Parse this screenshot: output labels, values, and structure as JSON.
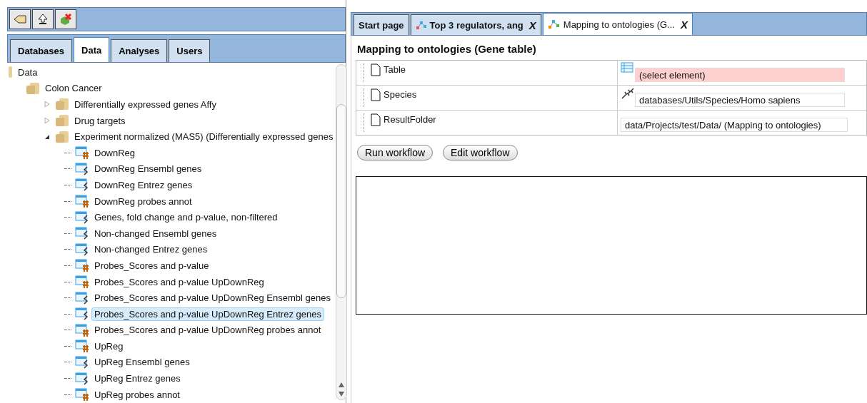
{
  "left_tabs": [
    {
      "label": "Databases",
      "selected": false
    },
    {
      "label": "Data",
      "selected": true
    },
    {
      "label": "Analyses",
      "selected": false
    },
    {
      "label": "Users",
      "selected": false
    }
  ],
  "tree": [
    {
      "label": "Data",
      "kind": "root",
      "selected": false,
      "children": [
        {
          "label": "Colon Cancer",
          "kind": "folder",
          "selected": false,
          "children": [
            {
              "label": "Differentially expressed genes Affy",
              "kind": "folder",
              "expanded": false,
              "selected": false
            },
            {
              "label": "Drug targets",
              "kind": "folder",
              "expanded": false,
              "selected": false
            },
            {
              "label": "Experiment normalized (MAS5) (Differentially expressed genes",
              "kind": "folder",
              "expanded": true,
              "selected": false,
              "children": [
                {
                  "label": "DownReg",
                  "kind": "probes",
                  "selected": false
                },
                {
                  "label": "DownReg Ensembl genes",
                  "kind": "genes",
                  "selected": false
                },
                {
                  "label": "DownReg Entrez genes",
                  "kind": "genes",
                  "selected": false
                },
                {
                  "label": "DownReg probes annot",
                  "kind": "probes",
                  "selected": false
                },
                {
                  "label": "Genes, fold change and p-value, non-filtered",
                  "kind": "genes",
                  "selected": false
                },
                {
                  "label": "Non-changed Ensembl genes",
                  "kind": "genes",
                  "selected": false
                },
                {
                  "label": "Non-changed Entrez genes",
                  "kind": "genes",
                  "selected": false
                },
                {
                  "label": "Probes_Scores and p-value",
                  "kind": "probes",
                  "selected": false
                },
                {
                  "label": "Probes_Scores and p-value UpDownReg",
                  "kind": "probes",
                  "selected": false
                },
                {
                  "label": "Probes_Scores and p-value UpDownReg Ensembl genes",
                  "kind": "genes",
                  "selected": false
                },
                {
                  "label": "Probes_Scores and p-value UpDownReg Entrez genes",
                  "kind": "genes",
                  "selected": true
                },
                {
                  "label": "Probes_Scores and p-value UpDownReg probes annot",
                  "kind": "probes",
                  "selected": false
                },
                {
                  "label": "UpReg",
                  "kind": "probes",
                  "selected": false
                },
                {
                  "label": "UpReg Ensembl genes",
                  "kind": "genes",
                  "selected": false
                },
                {
                  "label": "UpReg Entrez genes",
                  "kind": "genes",
                  "selected": false
                },
                {
                  "label": "UpReg probes annot",
                  "kind": "probes",
                  "selected": false
                }
              ]
            }
          ]
        }
      ]
    }
  ],
  "doc_tabs": [
    {
      "label": "Start page",
      "kind": "plain",
      "selected": false
    },
    {
      "label": "Top 3 regulators, ang",
      "kind": "diagram",
      "close": "X",
      "selected": false
    },
    {
      "label": "Mapping to ontologies (G...",
      "kind": "workflow",
      "close": "X",
      "selected": true
    }
  ],
  "form": {
    "title": "Mapping to ontologies (Gene table)",
    "parameters": [
      {
        "name": "Table",
        "kind": "table",
        "value": "(select element)",
        "invalid": true
      },
      {
        "name": "Species",
        "kind": "species",
        "value": "databases/Utils/Species/Homo sapiens",
        "invalid": false
      },
      {
        "name": "ResultFolder",
        "kind": "folder",
        "value": "data/Projects/test/Data/ (Mapping to ontologies)",
        "invalid": false
      }
    ],
    "buttons": [
      "Run workflow",
      "Edit workflow"
    ]
  }
}
